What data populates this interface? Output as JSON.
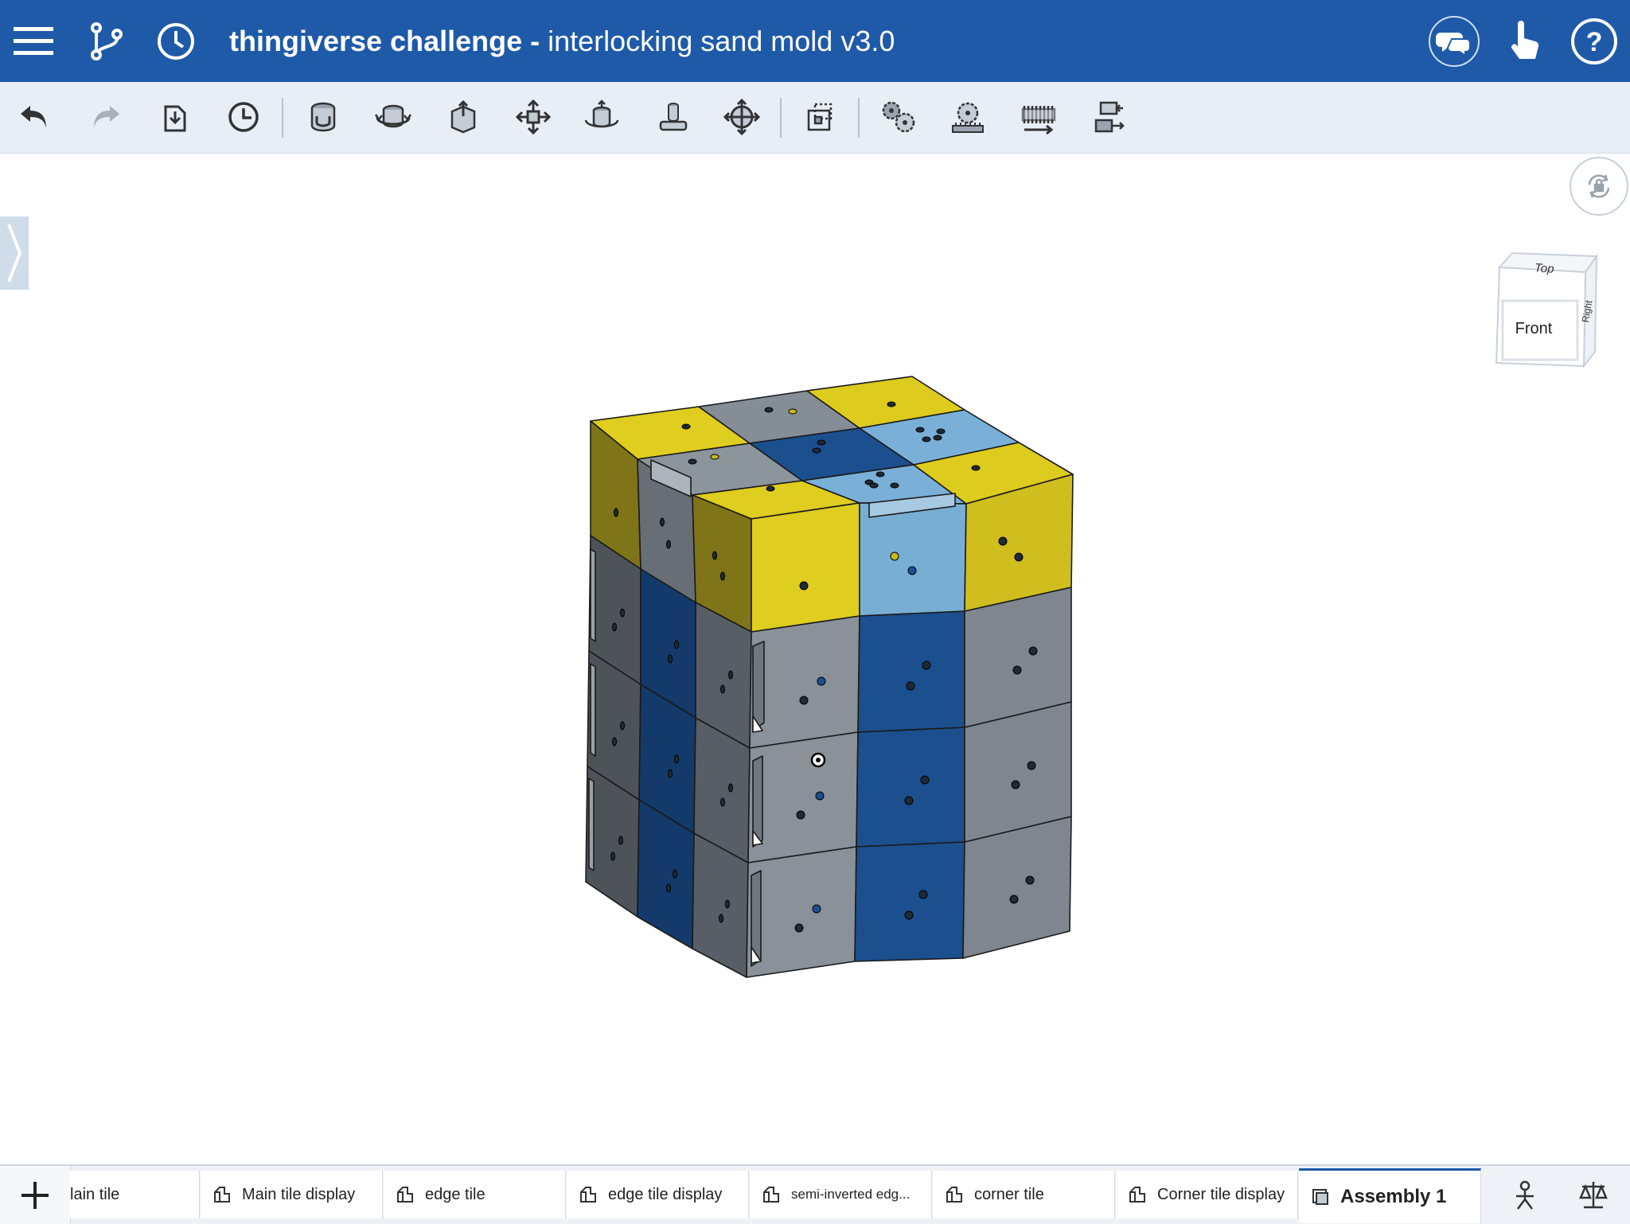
{
  "header": {
    "workspace": "thingiverse challenge",
    "separator": " - ",
    "document": "interlocking sand mold v3.0",
    "icons": [
      "menu-icon",
      "branch-icon",
      "history-icon",
      "comments-icon",
      "touch-icon",
      "help-icon"
    ]
  },
  "toolbar": {
    "tools": [
      "undo-icon",
      "redo-icon",
      "insert-icon",
      "sketch-clock-icon",
      "fastened-mate-icon",
      "revolute-mate-icon",
      "slider-mate-icon",
      "planar-mate-icon",
      "cylindrical-mate-icon",
      "pin-slot-mate-icon",
      "ball-mate-icon",
      "mate-connector-icon",
      "gear-relation-icon",
      "rack-pinion-icon",
      "screw-relation-icon",
      "linear-relation-icon"
    ]
  },
  "viewcube": {
    "top": "Top",
    "front": "Front",
    "right": "Right"
  },
  "tabs": [
    {
      "label": "lain tile",
      "icon": "part-studio-icon"
    },
    {
      "label": "Main tile display",
      "icon": "part-studio-icon"
    },
    {
      "label": "edge tile",
      "icon": "part-studio-icon"
    },
    {
      "label": "edge tile display",
      "icon": "part-studio-icon"
    },
    {
      "label": "semi-inverted edg...",
      "icon": "part-studio-icon"
    },
    {
      "label": "corner tile",
      "icon": "part-studio-icon"
    },
    {
      "label": "Corner tile display",
      "icon": "part-studio-icon"
    },
    {
      "label": "Assembly 1",
      "icon": "assembly-icon"
    }
  ],
  "colors": {
    "brand": "#1e5aa8",
    "yellow": "#d9c91c",
    "gray": "#7c838c",
    "dark_blue": "#1c4f8f",
    "light_blue": "#74a9cf"
  }
}
